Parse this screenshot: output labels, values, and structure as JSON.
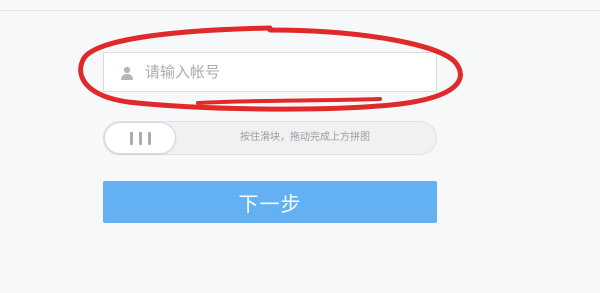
{
  "account_field": {
    "placeholder": "请输入帐号",
    "value": ""
  },
  "slider_captcha": {
    "hint": "按住滑块，拖动完成上方拼图"
  },
  "next_button": {
    "label": "下一步"
  },
  "icons": {
    "account": "user-icon",
    "slider": "grip-lines-icon"
  },
  "colors": {
    "page_background": "#f7f8fa",
    "button_background": "#63b0f2",
    "annotation": "#e02a2a"
  }
}
